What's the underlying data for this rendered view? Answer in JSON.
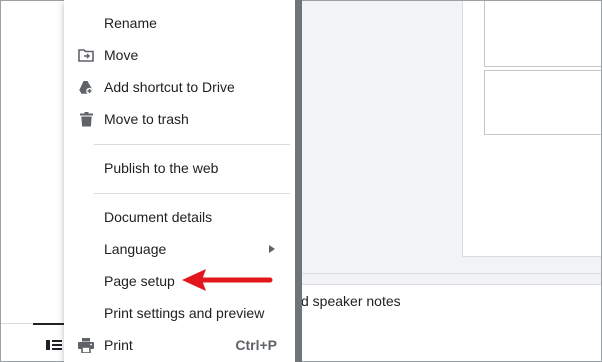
{
  "menu": {
    "items": [
      {
        "id": "rename",
        "label": "Rename",
        "icon": "none"
      },
      {
        "id": "move",
        "label": "Move",
        "icon": "folder-move-icon"
      },
      {
        "id": "add-shortcut",
        "label": "Add shortcut to Drive",
        "icon": "drive-shortcut-icon"
      },
      {
        "id": "move-to-trash",
        "label": "Move to trash",
        "icon": "trash-icon"
      },
      {
        "id": "publish",
        "label": "Publish to the web",
        "icon": "none"
      },
      {
        "id": "document-details",
        "label": "Document details",
        "icon": "none"
      },
      {
        "id": "language",
        "label": "Language",
        "icon": "none",
        "submenu": true
      },
      {
        "id": "page-setup",
        "label": "Page setup",
        "icon": "none"
      },
      {
        "id": "print-settings",
        "label": "Print settings and preview",
        "icon": "none"
      },
      {
        "id": "print",
        "label": "Print",
        "icon": "printer-icon",
        "shortcut": "Ctrl+P"
      }
    ]
  },
  "notes": {
    "partial_text": "d speaker notes"
  },
  "colors": {
    "accent_arrow": "#e3161b",
    "icon": "#5f6368",
    "text": "#202124",
    "divider": "#dadce0",
    "scrollbar": "#6f7478"
  }
}
